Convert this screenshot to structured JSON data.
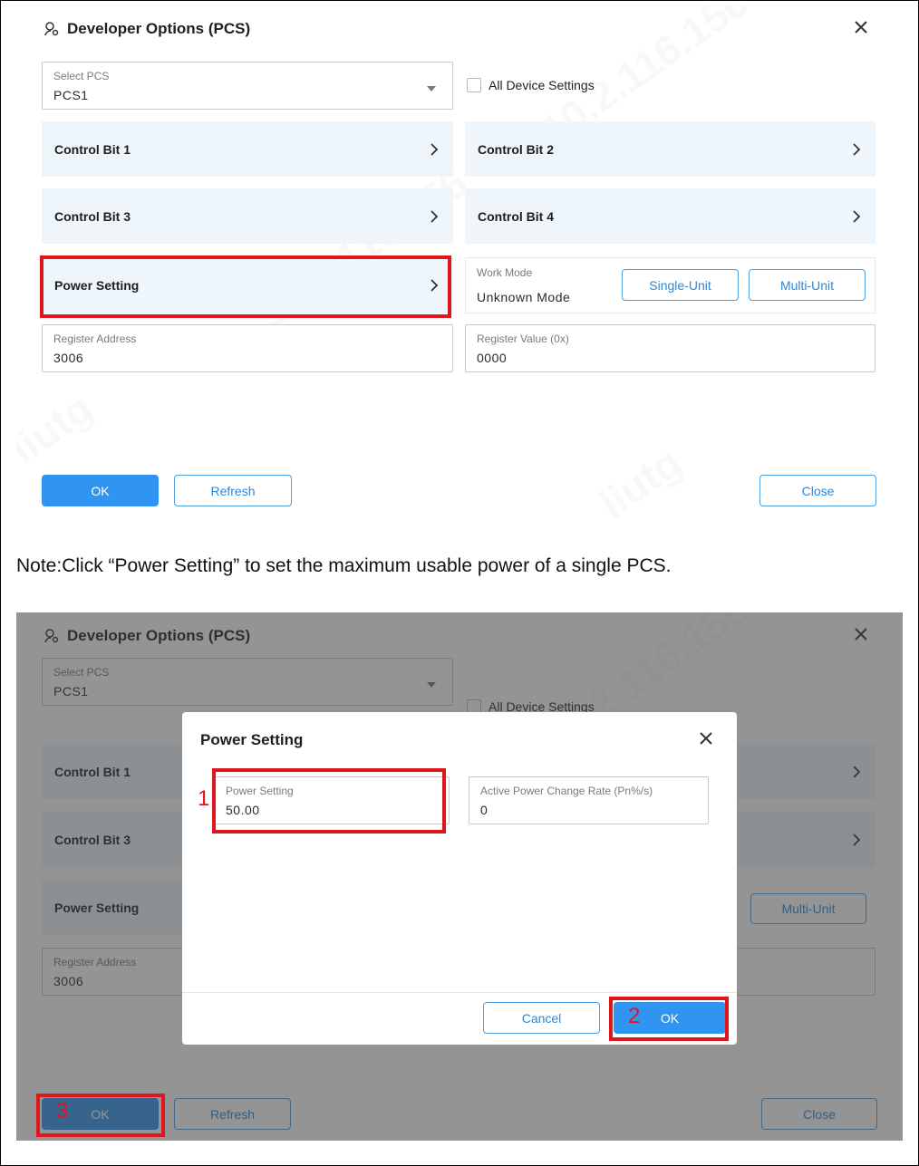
{
  "dialog": {
    "title": "Developer Options (PCS)",
    "select_pcs": {
      "label": "Select PCS",
      "value": "PCS1"
    },
    "all_device_settings": "All Device Settings",
    "cards": {
      "control_bit_1": "Control Bit 1",
      "control_bit_2": "Control Bit 2",
      "control_bit_3": "Control Bit 3",
      "control_bit_4": "Control Bit 4",
      "power_setting": "Power Setting"
    },
    "work_mode": {
      "label": "Work Mode",
      "value": "Unknown Mode",
      "single_unit": "Single-Unit",
      "multi_unit": "Multi-Unit"
    },
    "register_address": {
      "label": "Register Address",
      "value": "3006"
    },
    "register_value": {
      "label": "Register Value (0x)",
      "value": "0000"
    },
    "buttons": {
      "ok": "OK",
      "refresh": "Refresh",
      "close": "Close"
    },
    "watermark": [
      "10.2.116.156",
      "liutg"
    ]
  },
  "note": "Note:Click “Power Setting” to set the maximum usable power of a single PCS.",
  "modal": {
    "title": "Power Setting",
    "power_setting": {
      "label": "Power Setting",
      "value": "50.00"
    },
    "active_power_change_rate": {
      "label": "Active Power Change Rate (Pn%/s)",
      "value": "0"
    },
    "cancel": "Cancel",
    "ok": "OK"
  },
  "steps": [
    "1",
    "2",
    "3"
  ],
  "colors": {
    "accent": "#2f95f0",
    "card_bg": "#eef6fb",
    "highlight": "#e0161f"
  }
}
